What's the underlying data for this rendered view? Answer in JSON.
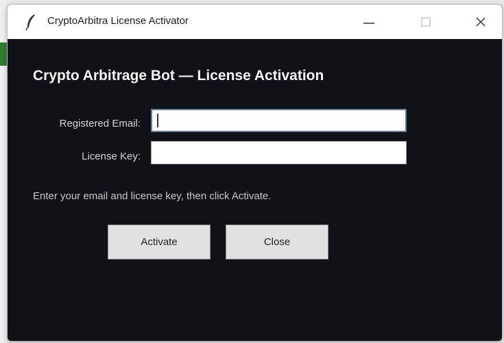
{
  "window": {
    "title": "CryptoArbitra License Activator",
    "controls": [
      "minimize",
      "maximize",
      "close"
    ]
  },
  "form": {
    "heading": "Crypto Arbitrage Bot — License Activation",
    "email_label": "Registered Email:",
    "email_value": "",
    "key_label": "License Key:",
    "key_value": "",
    "hint": "Enter your email and license key, then click Activate."
  },
  "buttons": {
    "activate_label": "Activate",
    "close_label": "Close"
  },
  "icons": {
    "app": "feather-icon",
    "minimize": "minimize-icon",
    "maximize": "maximize-icon",
    "close": "close-icon"
  },
  "colors": {
    "window_bg": "#111217",
    "titlebar_bg": "#ffffff",
    "button_bg": "#e1e1e1",
    "focus_border": "#5f7fa8"
  }
}
